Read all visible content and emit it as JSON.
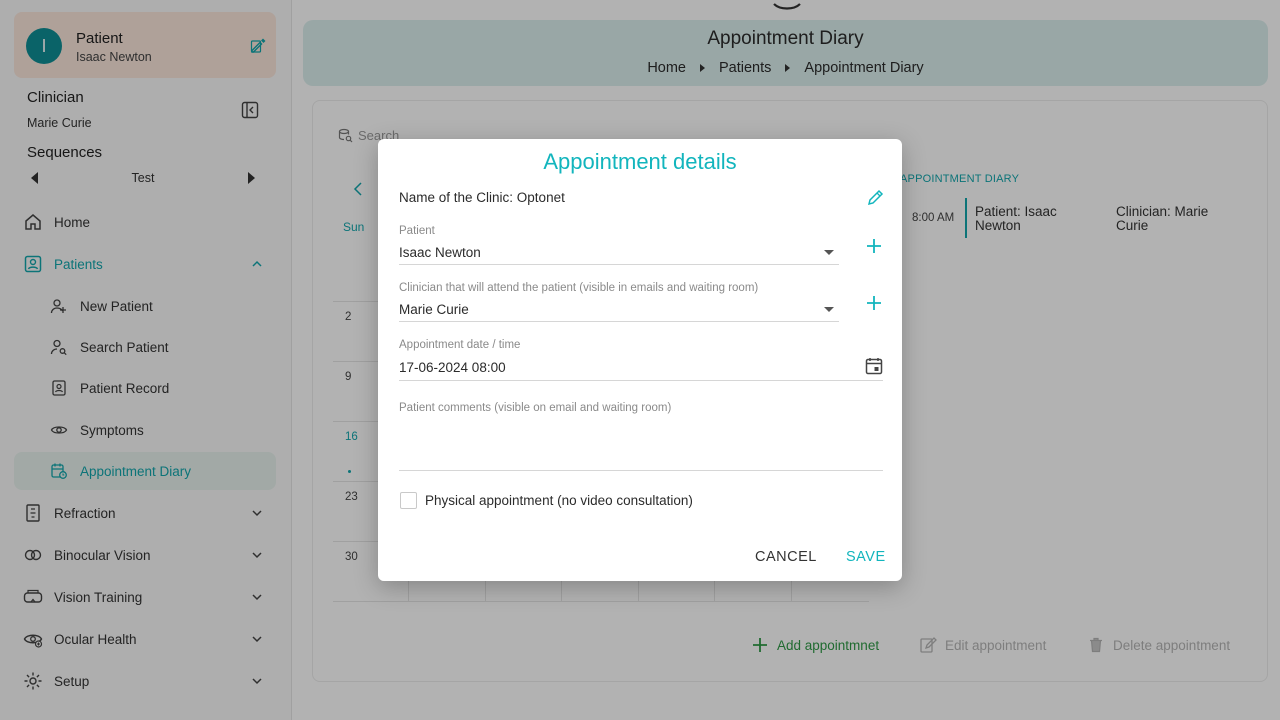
{
  "sidebar": {
    "patient_card": {
      "title": "Patient",
      "name": "Isaac Newton",
      "avatar_letter": "I"
    },
    "clinician": {
      "title": "Clinician",
      "name": "Marie Curie"
    },
    "sequences": {
      "title": "Sequences",
      "value": "Test"
    },
    "nav": [
      {
        "label": "Home",
        "icon": "home-icon"
      },
      {
        "label": "Patients",
        "icon": "patient-icon"
      },
      {
        "label": "New Patient",
        "icon": "add-person-icon"
      },
      {
        "label": "Search Patient",
        "icon": "search-person-icon"
      },
      {
        "label": "Patient Record",
        "icon": "record-icon"
      },
      {
        "label": "Symptoms",
        "icon": "eye-icon"
      },
      {
        "label": "Appointment Diary",
        "icon": "calendar-clock-icon"
      },
      {
        "label": "Refraction",
        "icon": "eye-chart-icon"
      },
      {
        "label": "Binocular Vision",
        "icon": "binocular-icon"
      },
      {
        "label": "Vision Training",
        "icon": "vr-icon"
      },
      {
        "label": "Ocular Health",
        "icon": "eye-health-icon"
      },
      {
        "label": "Setup",
        "icon": "gear-icon"
      }
    ]
  },
  "header": {
    "title": "Appointment Diary",
    "breadcrumbs": [
      "Home",
      "Patients",
      "Appointment Diary"
    ]
  },
  "calendar": {
    "search_placeholder": "Search",
    "weekday": "Sun",
    "days": [
      "2",
      "9",
      "16",
      "23",
      "30"
    ],
    "today": "16"
  },
  "diary": {
    "label": "APPOINTMENT DIARY",
    "time": "8:00 AM",
    "patient": "Patient: Isaac Newton",
    "clinician": "Clinician: Marie Curie"
  },
  "actions": {
    "add": "Add appointmnet",
    "edit": "Edit appointment",
    "delete": "Delete appointment"
  },
  "modal": {
    "title": "Appointment details",
    "clinic": "Name of the Clinic: Optonet",
    "patient_label": "Patient",
    "patient_value": "Isaac Newton",
    "clinician_label": "Clinician that will attend the patient (visible in emails and waiting room)",
    "clinician_value": "Marie Curie",
    "date_label": "Appointment date / time",
    "date_value": "17-06-2024 08:00",
    "comments_label": "Patient comments (visible on email and waiting room)",
    "comments_value": "",
    "checkbox_label": "Physical appointment (no video consultation)",
    "checkbox_checked": false,
    "cancel": "CANCEL",
    "save": "SAVE"
  },
  "colors": {
    "accent": "#12b5bd",
    "add_green": "#2e9a46",
    "header_bg": "#dcefee",
    "patient_card_bg": "#fbe7dc"
  }
}
